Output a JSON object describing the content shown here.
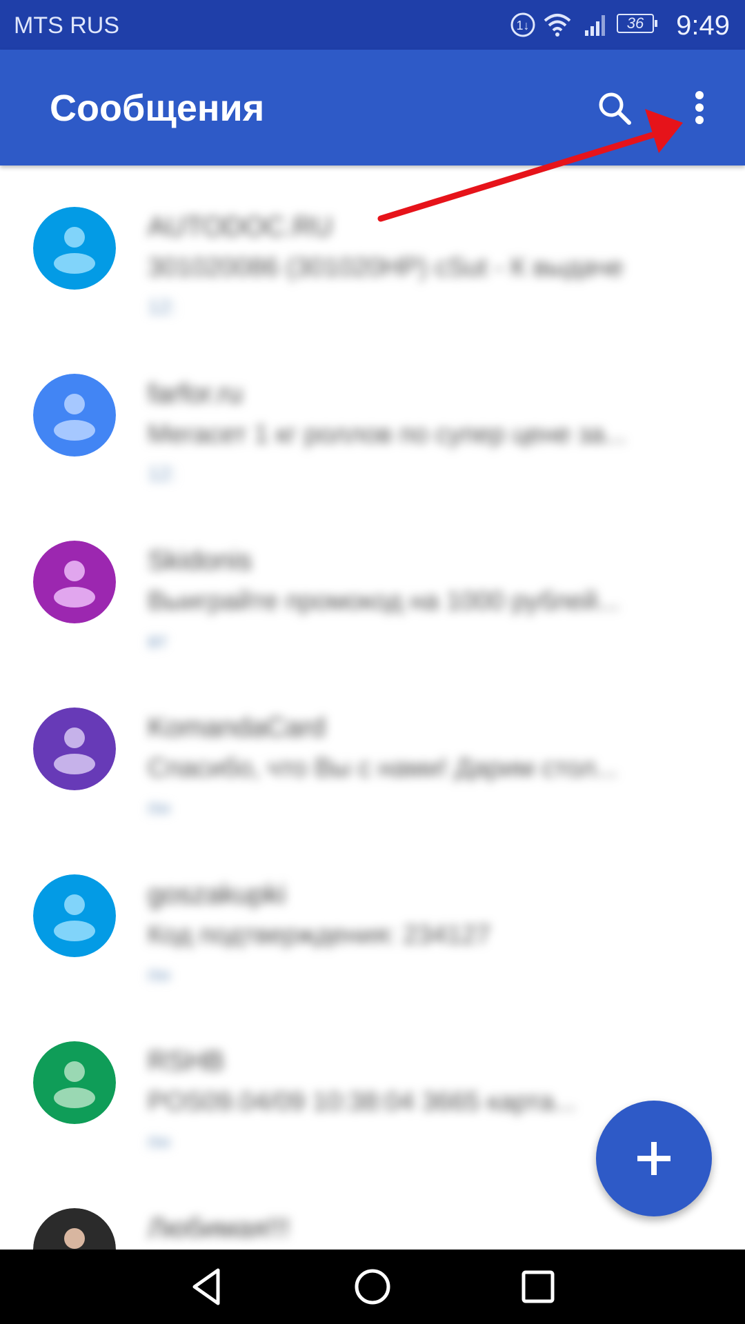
{
  "status_bar": {
    "carrier": "MTS RUS",
    "battery": "36",
    "time": "9:49",
    "icons": [
      "data-icon",
      "wifi-icon",
      "signal-icon",
      "battery-icon"
    ]
  },
  "app_bar": {
    "title": "Сообщения",
    "actions": [
      "search-icon",
      "more-vert-icon"
    ]
  },
  "conversations": [
    {
      "sender": "AUTODOC.RU",
      "preview": "301020086 (301020HP) cSut - К выдаче",
      "time": "12:",
      "avatar_color": "#039be5",
      "avatar_fg": "#81d4fa"
    },
    {
      "sender": "farfor.ru",
      "preview": "Мегасет 1 кг роллов по супер цене за...",
      "time": "12:",
      "avatar_color": "#4285f4",
      "avatar_fg": "#a6c8ff"
    },
    {
      "sender": "Skidonis",
      "preview": "Выиграйте промокод на 1000 рублей...",
      "time": "вт",
      "avatar_color": "#9c27b0",
      "avatar_fg": "#e1a6ee"
    },
    {
      "sender": "KomandaCard",
      "preview": "Спасибо, что Вы с нами! Дарим стол...",
      "time": "пн",
      "avatar_color": "#673ab7",
      "avatar_fg": "#c6b2ea"
    },
    {
      "sender": "goszakupki",
      "preview": "Код подтверждения: 234127",
      "time": "пн",
      "avatar_color": "#039be5",
      "avatar_fg": "#81d4fa"
    },
    {
      "sender": "RSHB",
      "preview": "POS09.04/09 10:38:04 3665 карта...",
      "time": "пн",
      "avatar_color": "#0f9d58",
      "avatar_fg": "#9ad8b3"
    },
    {
      "sender": "Любимая!!!",
      "preview": "",
      "time": "",
      "avatar_color": "#2b2b2b",
      "avatar_fg": "#d8b6a0"
    }
  ],
  "fab": {
    "icon": "plus-icon"
  },
  "nav_bar": {
    "buttons": [
      "back-icon",
      "home-icon",
      "recents-icon"
    ]
  },
  "annotation": {
    "type": "arrow",
    "color": "#e6131a",
    "points_to": "more-vert-icon"
  }
}
